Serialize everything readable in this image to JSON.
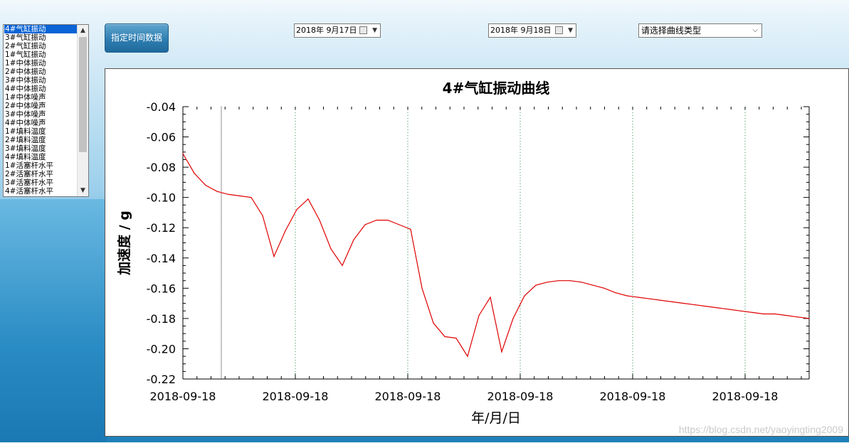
{
  "listbox": {
    "items": [
      "4#气缸振动",
      "3#气缸振动",
      "2#气缸振动",
      "1#气缸振动",
      "1#中体振动",
      "2#中体振动",
      "3#中体振动",
      "4#中体振动",
      "1#中体噪声",
      "2#中体噪声",
      "3#中体噪声",
      "4#中体噪声",
      "1#填料温度",
      "2#填料温度",
      "3#填料温度",
      "4#填料温度",
      "1#活塞杆水平",
      "2#活塞杆水平",
      "3#活塞杆水平",
      "4#活塞杆水平"
    ],
    "selected_index": 0
  },
  "toolbar": {
    "query_button_label": "指定时间数据",
    "start_date": "2018年 9月17日",
    "end_date": "2018年 9月18日",
    "curve_type_placeholder": "请选择曲线类型"
  },
  "watermark": "https://blog.csdn.net/yaoyingting2009",
  "chart_data": {
    "type": "line",
    "title": "4#气缸振动曲线",
    "xlabel": "年/月/日",
    "ylabel": "加速度 / g",
    "ylim": [
      -0.22,
      -0.04
    ],
    "yticks": [
      "-0.04",
      "-0.06",
      "-0.08",
      "-0.10",
      "-0.12",
      "-0.14",
      "-0.16",
      "-0.18",
      "-0.20",
      "-0.22"
    ],
    "xticks": [
      "2018-09-18",
      "2018-09-18",
      "2018-09-18",
      "2018-09-18",
      "2018-09-18",
      "2018-09-18"
    ],
    "line_color": "#e00000",
    "grid": "vertical dotted",
    "series": [
      {
        "values": [
          -0.071,
          -0.084,
          -0.092,
          -0.096,
          -0.098,
          -0.099,
          -0.1,
          -0.112,
          -0.139,
          -0.122,
          -0.108,
          -0.101,
          -0.115,
          -0.134,
          -0.145,
          -0.128,
          -0.118,
          -0.115,
          -0.115,
          -0.118,
          -0.121,
          -0.16,
          -0.183,
          -0.192,
          -0.193,
          -0.205,
          -0.178,
          -0.166,
          -0.202,
          -0.18,
          -0.165,
          -0.158,
          -0.156,
          -0.155,
          -0.155,
          -0.156,
          -0.158,
          -0.16,
          -0.163,
          -0.165,
          -0.166,
          -0.167,
          -0.168,
          -0.169,
          -0.17,
          -0.171,
          -0.172,
          -0.173,
          -0.174,
          -0.175,
          -0.176,
          -0.177,
          -0.177,
          -0.178,
          -0.179,
          -0.18
        ]
      }
    ]
  }
}
